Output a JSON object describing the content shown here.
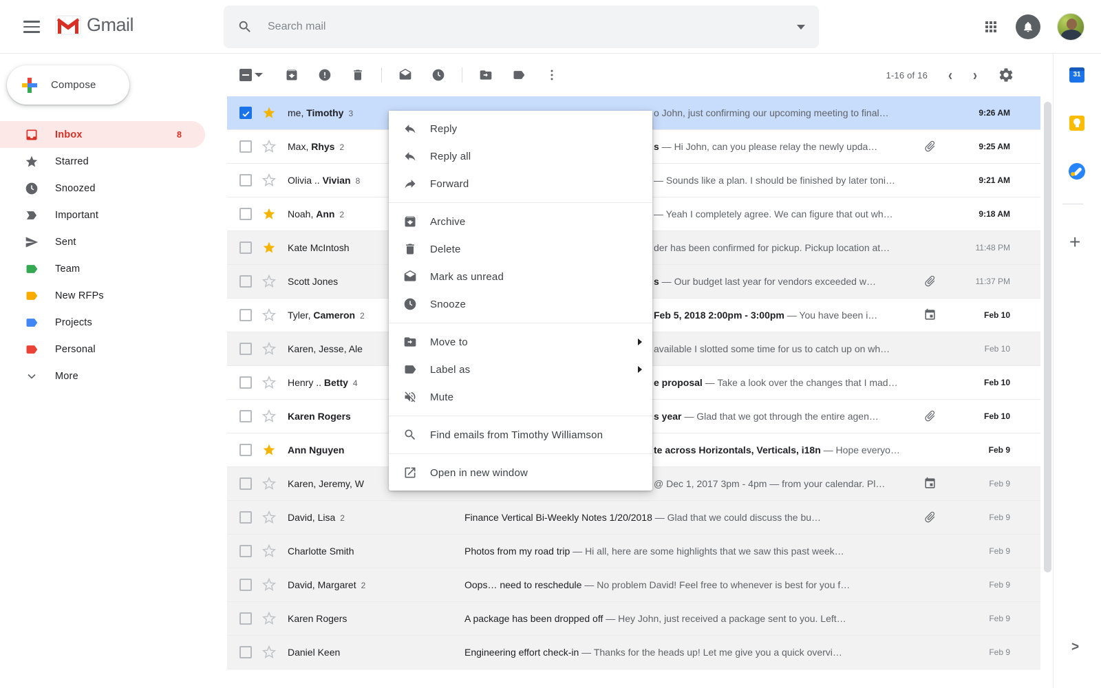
{
  "topbar": {
    "logo_text": "Gmail",
    "search_placeholder": "Search mail"
  },
  "sidebar": {
    "compose_label": "Compose",
    "items": [
      {
        "icon": "inbox-icon",
        "label": "Inbox",
        "count": "8",
        "active": true,
        "color": "#d93025"
      },
      {
        "icon": "star-icon",
        "label": "Starred"
      },
      {
        "icon": "clock-icon",
        "label": "Snoozed"
      },
      {
        "icon": "important-icon",
        "label": "Important"
      },
      {
        "icon": "send-icon",
        "label": "Sent"
      },
      {
        "icon": "tag-icon",
        "label": "Team",
        "color": "#34a853"
      },
      {
        "icon": "tag-icon",
        "label": "New RFPs",
        "color": "#f9ab00"
      },
      {
        "icon": "tag-icon",
        "label": "Projects",
        "color": "#4285f4"
      },
      {
        "icon": "tag-icon",
        "label": "Personal",
        "color": "#ea4335"
      },
      {
        "icon": "chevron-down-icon",
        "label": "More"
      }
    ]
  },
  "toolbar": {
    "left_icons": [
      "select-checkbox",
      "select-caret",
      "archive-icon",
      "report-spam-icon",
      "delete-icon",
      "divider",
      "mark-read-icon",
      "snooze-icon",
      "divider",
      "move-to-icon",
      "label-icon",
      "more-vert-icon"
    ],
    "pagination": "1-16 of 16",
    "prev": "‹",
    "next": "›"
  },
  "context_menu": {
    "groups": [
      [
        {
          "icon": "reply-icon",
          "label": "Reply"
        },
        {
          "icon": "reply-all-icon",
          "label": "Reply all"
        },
        {
          "icon": "forward-icon",
          "label": "Forward"
        }
      ],
      [
        {
          "icon": "archive-icon",
          "label": "Archive"
        },
        {
          "icon": "delete-icon",
          "label": "Delete"
        },
        {
          "icon": "mark-unread-icon",
          "label": "Mark as unread"
        },
        {
          "icon": "snooze-icon",
          "label": "Snooze"
        }
      ],
      [
        {
          "icon": "move-to-icon",
          "label": "Move to",
          "submenu": true
        },
        {
          "icon": "label-icon",
          "label": "Label as",
          "submenu": true
        },
        {
          "icon": "mute-icon",
          "label": "Mute"
        }
      ],
      [
        {
          "icon": "search-icon",
          "label": "Find emails from Timothy Williamson"
        }
      ],
      [
        {
          "icon": "open-new-icon",
          "label": "Open in new window"
        }
      ]
    ]
  },
  "list": {
    "rows": [
      {
        "bg": "selected",
        "checked": true,
        "starred": true,
        "sender": [
          {
            "t": "me, "
          },
          {
            "t": "Timothy",
            "b": true
          }
        ],
        "count": "3",
        "frag": {
          "b": "",
          "n": "o John, just confirming our upcoming meeting to final…"
        },
        "icon": null,
        "date": "9:26 AM",
        "date_bold": true
      },
      {
        "bg": "unread",
        "checked": false,
        "starred": false,
        "sender": [
          {
            "t": "Max, "
          },
          {
            "t": "Rhys",
            "b": true
          }
        ],
        "count": "2",
        "frag": {
          "b": "s",
          "n": " — Hi John, can you please relay the newly upda…"
        },
        "icon": "paperclip-icon",
        "date": "9:25 AM",
        "date_bold": true
      },
      {
        "bg": "unread",
        "checked": false,
        "starred": false,
        "sender": [
          {
            "t": "Olivia .. "
          },
          {
            "t": "Vivian",
            "b": true
          }
        ],
        "count": "8",
        "frag": {
          "b": "",
          "n": "— Sounds like a plan. I should be finished by later toni…"
        },
        "icon": null,
        "date": "9:21 AM",
        "date_bold": true
      },
      {
        "bg": "unread",
        "checked": false,
        "starred": true,
        "sender": [
          {
            "t": "Noah, "
          },
          {
            "t": "Ann",
            "b": true
          }
        ],
        "count": "2",
        "frag": {
          "b": "",
          "n": "— Yeah I completely agree. We can figure that out wh…"
        },
        "icon": null,
        "date": "9:18 AM",
        "date_bold": true
      },
      {
        "bg": "read",
        "checked": false,
        "starred": true,
        "sender": [
          {
            "t": "Kate McIntosh"
          }
        ],
        "count": "",
        "frag": {
          "b": "",
          "n": "der has been confirmed for pickup. Pickup location at…"
        },
        "icon": null,
        "date": "11:48 PM",
        "date_bold": false
      },
      {
        "bg": "read",
        "checked": false,
        "starred": false,
        "sender": [
          {
            "t": "Scott Jones"
          }
        ],
        "count": "",
        "frag": {
          "b": "s",
          "n": " — Our budget last year for vendors exceeded w…"
        },
        "icon": "paperclip-icon",
        "date": "11:37 PM",
        "date_bold": false
      },
      {
        "bg": "unread",
        "checked": false,
        "starred": false,
        "sender": [
          {
            "t": "Tyler, "
          },
          {
            "t": "Cameron",
            "b": true
          }
        ],
        "count": "2",
        "frag": {
          "b": "Feb 5, 2018 2:00pm - 3:00pm",
          "n": " — You have been i…"
        },
        "icon": "calendar-icon",
        "date": "Feb 10",
        "date_bold": true
      },
      {
        "bg": "read",
        "checked": false,
        "starred": false,
        "sender": [
          {
            "t": "Karen, Jesse, Ale"
          }
        ],
        "count": "",
        "frag": {
          "b": "",
          "n": "available I slotted some time for us to catch up on wh…"
        },
        "icon": null,
        "date": "Feb 10",
        "date_bold": false
      },
      {
        "bg": "unread",
        "checked": false,
        "starred": false,
        "sender": [
          {
            "t": "Henry .. "
          },
          {
            "t": "Betty",
            "b": true
          }
        ],
        "count": "4",
        "frag": {
          "b": "e proposal",
          "n": " — Take a look over the changes that I mad…"
        },
        "icon": null,
        "date": "Feb 10",
        "date_bold": true
      },
      {
        "bg": "unread",
        "checked": false,
        "starred": false,
        "sender": [
          {
            "t": "Karen Rogers",
            "b": true
          }
        ],
        "count": "",
        "frag": {
          "b": "s year",
          "n": " — Glad that we got through the entire agen…"
        },
        "icon": "paperclip-icon",
        "date": "Feb 10",
        "date_bold": true
      },
      {
        "bg": "unread",
        "checked": false,
        "starred": true,
        "sender": [
          {
            "t": "Ann Nguyen",
            "b": true
          }
        ],
        "count": "",
        "frag": {
          "b": "te across Horizontals, Verticals, i18n",
          "n": " — Hope everyo…"
        },
        "icon": null,
        "date": "Feb 9",
        "date_bold": true
      },
      {
        "bg": "read",
        "checked": false,
        "starred": false,
        "sender": [
          {
            "t": "Karen, Jeremy, W"
          }
        ],
        "count": "",
        "frag": {
          "b": "",
          "n": "@ Dec 1, 2017 3pm - 4pm — from your calendar. Pl…"
        },
        "icon": "calendar-icon",
        "date": "Feb 9",
        "date_bold": false
      },
      {
        "bg": "read",
        "checked": false,
        "starred": false,
        "sender": [
          {
            "t": "David, Lisa"
          }
        ],
        "count": "2",
        "subject": "Finance Vertical Bi-Weekly Notes 1/20/2018",
        "snippet": "Glad that we could discuss the bu…",
        "icon": "paperclip-icon",
        "date": "Feb 9",
        "date_bold": false
      },
      {
        "bg": "read",
        "checked": false,
        "starred": false,
        "sender": [
          {
            "t": "Charlotte Smith"
          }
        ],
        "count": "",
        "subject": "Photos from my road trip",
        "snippet": "Hi all, here are some highlights that we saw this past week…",
        "icon": null,
        "date": "Feb 9",
        "date_bold": false
      },
      {
        "bg": "read",
        "checked": false,
        "starred": false,
        "sender": [
          {
            "t": "David, Margaret"
          }
        ],
        "count": "2",
        "subject": "Oops… need to reschedule",
        "snippet": "No problem David! Feel free to whenever is best for you f…",
        "icon": null,
        "date": "Feb 9",
        "date_bold": false
      },
      {
        "bg": "read",
        "checked": false,
        "starred": false,
        "sender": [
          {
            "t": "Karen Rogers"
          }
        ],
        "count": "",
        "subject": "A package has been dropped off",
        "snippet": "Hey John, just received a package sent to you. Left…",
        "icon": null,
        "date": "Feb 9",
        "date_bold": false
      },
      {
        "bg": "read",
        "checked": false,
        "starred": false,
        "sender": [
          {
            "t": "Daniel Keen"
          }
        ],
        "count": "",
        "subject": "Engineering effort check-in",
        "snippet": "Thanks for the heads up! Let me give you a quick overvi…",
        "icon": null,
        "date": "Feb 9",
        "date_bold": false
      }
    ],
    "snippet_separator": " — "
  },
  "right_rail": {
    "calendar_label": "31",
    "icons": [
      "calendar-icon",
      "keep-icon",
      "tasks-icon",
      "plus-icon",
      "chevron-right-icon"
    ]
  },
  "colors": {
    "accent_blue": "#1a73e8",
    "selected_row": "#c8dcfb",
    "inbox_red": "#d93025",
    "inbox_pill": "#fce8e6",
    "star_yellow": "#f4b400",
    "icon_gray": "#5f6368",
    "read_row": "#f2f2f2"
  }
}
